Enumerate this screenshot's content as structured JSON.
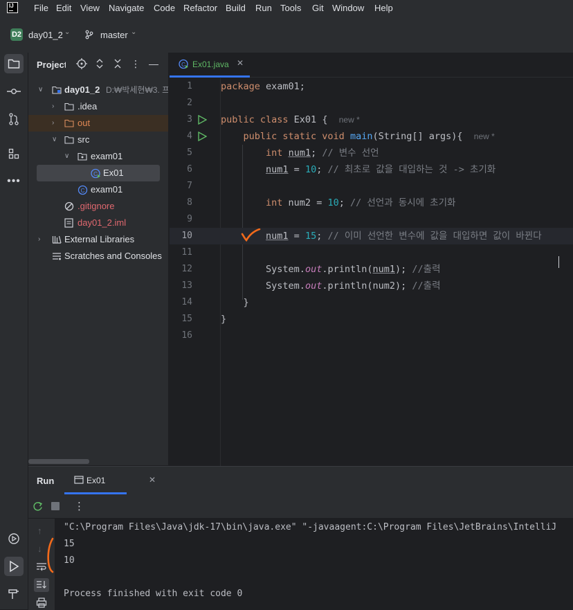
{
  "menu": [
    "File",
    "Edit",
    "View",
    "Navigate",
    "Code",
    "Refactor",
    "Build",
    "Run",
    "Tools",
    "Git",
    "Window",
    "Help"
  ],
  "toolbar": {
    "project_badge": "D2",
    "project_name": "day01_2",
    "branch": "master"
  },
  "project_panel": {
    "title": "Project",
    "tree": [
      {
        "label": "day01_2",
        "path": "D:₩박세현₩3. 프",
        "type": "module",
        "level": 0,
        "arrow": "∨"
      },
      {
        "label": ".idea",
        "type": "folder",
        "level": 1,
        "arrow": "›"
      },
      {
        "label": "out",
        "type": "folder-excluded",
        "level": 1,
        "arrow": "›"
      },
      {
        "label": "src",
        "type": "folder",
        "level": 1,
        "arrow": "∨"
      },
      {
        "label": "exam01",
        "type": "package",
        "level": 2,
        "arrow": "∨"
      },
      {
        "label": "Ex01",
        "type": "class-run",
        "level": 3,
        "arrow": ""
      },
      {
        "label": "exam01",
        "type": "class",
        "level": 2,
        "arrow": ""
      },
      {
        "label": ".gitignore",
        "type": "ignore",
        "level": 1,
        "arrow": ""
      },
      {
        "label": "day01_2.iml",
        "type": "iml",
        "level": 1,
        "arrow": ""
      },
      {
        "label": "External Libraries",
        "type": "library",
        "level": 0,
        "arrow": "›"
      },
      {
        "label": "Scratches and Consoles",
        "type": "scratch",
        "level": 0,
        "arrow": ""
      }
    ]
  },
  "editor": {
    "tab": "Ex01.java",
    "current_line": 10,
    "line_numbers": [
      "1",
      "2",
      "3",
      "4",
      "5",
      "6",
      "7",
      "8",
      "9",
      "10",
      "11",
      "12",
      "13",
      "14",
      "15",
      "16"
    ],
    "tokens": {
      "l1_kw": "package",
      "l1_rest": " exam01;",
      "l3_kw": "public class",
      "l3_rest": " Ex01 {",
      "l3_hint": "new *",
      "l4_kw": "public static void",
      "l4_fn": "main",
      "l4_rest": "(String[] args){",
      "l4_hint": "new *",
      "l5_kw": "int",
      "l5_var": "num1",
      "l5_rest": ";",
      "l5_cm": "// 변수 선언",
      "l6_var": "num1",
      "l6_mid": " = ",
      "l6_num": "10",
      "l6_rest": ";",
      "l6_cm": "// 최초로 값을 대입하는 것 -> 초기화",
      "l8_kw": "int",
      "l8_mid": " num2 = ",
      "l8_num": "10",
      "l8_rest": ";",
      "l8_cm": "// 선언과 동시에 초기화",
      "l10_var": "num1",
      "l10_mid": " = ",
      "l10_num": "15",
      "l10_rest": ";",
      "l10_cm": "// 이미 선언한 변수에 값을 대입하면 값이 바뀐다",
      "l12_pre": "System.",
      "l12_out": "out",
      "l12_mid": ".println(",
      "l12_var": "num1",
      "l12_rest": ");",
      "l12_cm": "//출력",
      "l13_pre": "System.",
      "l13_out": "out",
      "l13_mid": ".println(num2);",
      "l13_cm": "//출력",
      "l14": "}",
      "l15": "}"
    }
  },
  "run_panel": {
    "title": "Run",
    "tab": "Ex01",
    "console": [
      "\"C:\\Program Files\\Java\\jdk-17\\bin\\java.exe\" \"-javaagent:C:\\Program Files\\JetBrains\\IntelliJ",
      "15",
      "10",
      "",
      "Process finished with exit code 0"
    ]
  },
  "colors": {
    "accent": "#3574f0",
    "run_green": "#5fb865",
    "annotation": "#f26a1b"
  },
  "icons": [
    "folder-icon",
    "commit-icon",
    "pull-request-icon",
    "structure-icon",
    "more-icon",
    "services-icon",
    "run-icon",
    "build-icon"
  ]
}
